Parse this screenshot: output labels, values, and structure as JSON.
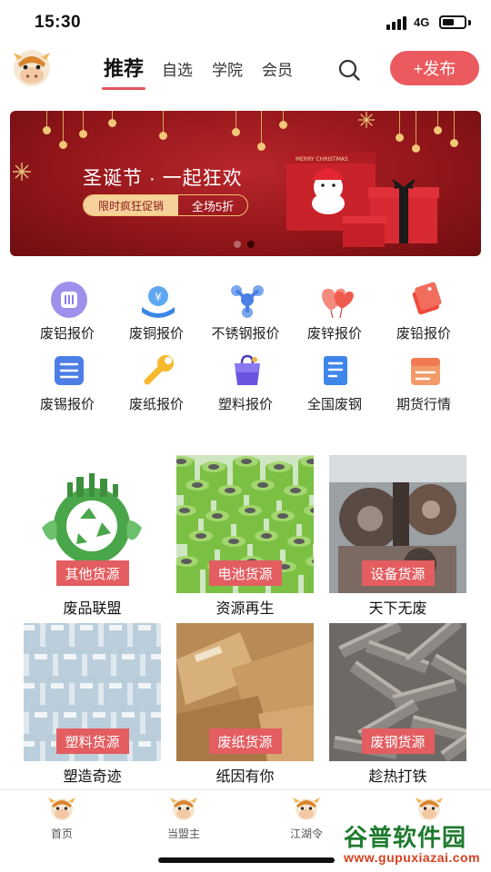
{
  "status_bar": {
    "time": "15:30",
    "network": "4G",
    "battery_level": 0.55
  },
  "header": {
    "tabs": [
      {
        "label": "推荐",
        "active": true
      },
      {
        "label": "自选",
        "active": false
      },
      {
        "label": "学院",
        "active": false
      },
      {
        "label": "会员",
        "active": false
      }
    ],
    "publish_label": "+发布"
  },
  "banner": {
    "title": "圣诞节 · 一起狂欢",
    "promo_left": "限时疯狂促销",
    "promo_right": "全场5折",
    "art_text": "MERRY CHRISTMAS",
    "slide_count": 2,
    "active_slide": 2
  },
  "categories": [
    {
      "label": "废铝报价",
      "icon": "aluminum-icon",
      "color": "#8e7de8"
    },
    {
      "label": "废铜报价",
      "icon": "copper-icon",
      "color": "#3b86e8"
    },
    {
      "label": "不锈钢报价",
      "icon": "stainless-steel-icon",
      "color": "#4a7fe4"
    },
    {
      "label": "废锌报价",
      "icon": "zinc-icon",
      "color": "#f05a4c"
    },
    {
      "label": "废铅报价",
      "icon": "lead-icon",
      "color": "#ee4a3c"
    },
    {
      "label": "废锡报价",
      "icon": "tin-icon",
      "color": "#4d7ee6"
    },
    {
      "label": "废纸报价",
      "icon": "paper-icon",
      "color": "#f6b92d"
    },
    {
      "label": "塑料报价",
      "icon": "plastic-icon",
      "color": "#6a55e0"
    },
    {
      "label": "全国废钢",
      "icon": "steel-icon",
      "color": "#3f86ea"
    },
    {
      "label": "期货行情",
      "icon": "futures-icon",
      "color": "#f39a6a"
    }
  ],
  "resources": [
    {
      "badge": "其他货源",
      "caption": "废品联盟",
      "image": "recycle-globe"
    },
    {
      "badge": "电池货源",
      "caption": "资源再生",
      "image": "batteries"
    },
    {
      "badge": "设备货源",
      "caption": "天下无废",
      "image": "machinery"
    },
    {
      "badge": "塑料货源",
      "caption": "塑造奇迹",
      "image": "plastic-bottles"
    },
    {
      "badge": "废纸货源",
      "caption": "纸因有你",
      "image": "cardboard"
    },
    {
      "badge": "废钢货源",
      "caption": "趁热打铁",
      "image": "steel-scrap"
    }
  ],
  "tabbar": [
    {
      "label": "首页",
      "icon": "cow-mascot-icon"
    },
    {
      "label": "当盟主",
      "icon": "cow-mascot-icon"
    },
    {
      "label": "江湖令",
      "icon": "cow-mascot-icon"
    },
    {
      "label": "",
      "icon": "cow-mascot-icon"
    }
  ],
  "watermark": {
    "title": "谷普软件园",
    "url": "www.gupuxiazai.com"
  },
  "colors": {
    "accent": "#ea5a5e",
    "banner_red": "#a21d22",
    "badge_red": "#e35d61"
  }
}
